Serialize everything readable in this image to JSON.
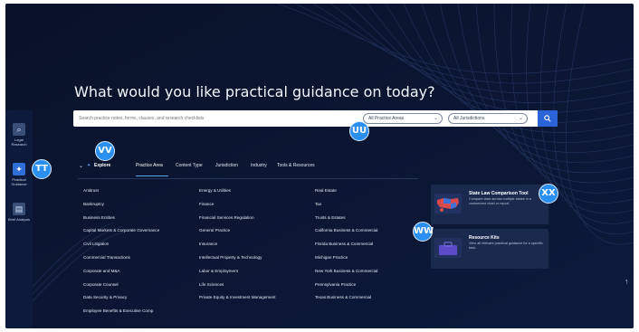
{
  "rail": {
    "items": [
      {
        "label": "Legal Research",
        "icon": "legal-research-icon"
      },
      {
        "label": "Practical Guidance",
        "icon": "practical-guidance-icon"
      },
      {
        "label": "Brief Analysis",
        "icon": "brief-analysis-icon"
      }
    ]
  },
  "heading": "What would you like practical guidance on today?",
  "search": {
    "placeholder": "Search practice notes, forms, clauses, and research checklists",
    "practice_area_select": "All Practice Areas",
    "jurisdiction_select": "All Jurisdictions",
    "button_icon": "search-icon"
  },
  "explore": {
    "label": "Explore",
    "tabs": [
      "Practice Area",
      "Content Type",
      "Jurisdiction",
      "Industry",
      "Tools & Resources"
    ],
    "active_tab": "Practice Area"
  },
  "practice_areas": {
    "col1": [
      "Antitrust",
      "Bankruptcy",
      "Business Entities",
      "Capital Markets & Corporate Governance",
      "Civil Litigation",
      "Commercial Transactions",
      "Corporate and M&A",
      "Corporate Counsel",
      "Data Security & Privacy",
      "Employee Benefits & Executive Comp"
    ],
    "col2": [
      "Energy & Utilities",
      "Finance",
      "Financial Services Regulation",
      "General Practice",
      "Insurance",
      "Intellectual Property & Technology",
      "Labor & Employment",
      "Life Sciences",
      "Private Equity & Investment Management"
    ],
    "col3": [
      "Real Estate",
      "Tax",
      "Trusts & Estates",
      "California Business & Commercial",
      "Florida Business & Commercial",
      "Michigan Practice",
      "New York Business & Commercial",
      "Pennsylvania Practice",
      "Texas Business & Commercial"
    ]
  },
  "cards": [
    {
      "title": "State Law Comparison Tool",
      "desc": "Compare laws across multiple states in a customized chart or report."
    },
    {
      "title": "Resource Kits",
      "desc": "View all relevant practical guidance for a specific task."
    }
  ],
  "markers": {
    "tt": "TT",
    "uu": "UU",
    "vv": "VV",
    "ww": "WW",
    "xx": "XX"
  },
  "colors": {
    "accent": "#2b63d8",
    "background": "#0b1430",
    "marker": "#2b8ff0"
  }
}
